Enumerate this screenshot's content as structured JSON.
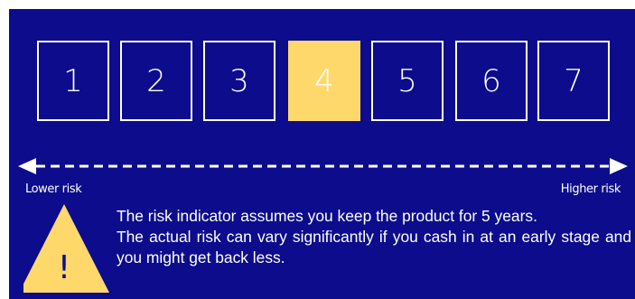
{
  "risk_scale": {
    "levels": [
      "1",
      "2",
      "3",
      "4",
      "5",
      "6",
      "7"
    ],
    "selected_level": "4",
    "colors": {
      "background": "#0c0c8c",
      "highlight": "#ffd86b",
      "text": "#ffffff"
    }
  },
  "axis": {
    "lower_label": "Lower risk",
    "higher_label": "Higher risk"
  },
  "warning": {
    "icon": "warning-triangle-icon",
    "symbol": "!",
    "line1": "The risk indicator assumes you keep the product for 5 years.",
    "line2": "The actual risk can vary significantly if you cash in at an early stage and you might get back less."
  }
}
